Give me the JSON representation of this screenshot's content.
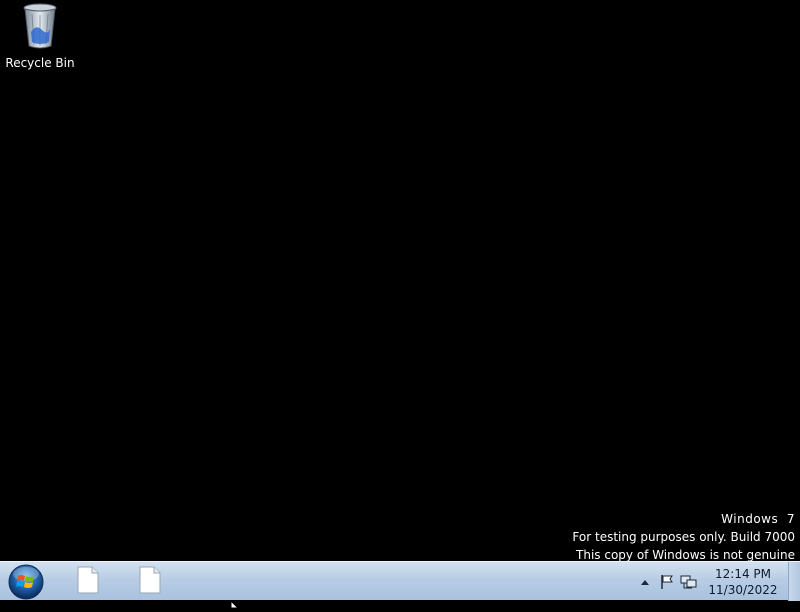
{
  "desktop": {
    "icons": [
      {
        "label": "Recycle Bin",
        "icon": "recycle-bin-icon"
      }
    ],
    "watermark": {
      "os": "Windows  7",
      "line2": "For testing purposes only. Build 7000",
      "line3": "This copy of Windows is not genuine"
    }
  },
  "taskbar": {
    "start_icon": "windows-logo-icon",
    "pinned": [
      {
        "icon": "blank-document-icon"
      },
      {
        "icon": "blank-document-icon"
      }
    ],
    "tray": {
      "icons": [
        "show-hidden-icons-arrow",
        "action-center-flag-icon",
        "network-icon"
      ],
      "time": "12:14 PM",
      "date": "11/30/2022"
    }
  },
  "colors": {
    "desktop_bg": "#000000",
    "taskbar_top": "#d3e1f0",
    "taskbar_bottom": "#a9c2de",
    "watermark_text": "#ffffff"
  }
}
